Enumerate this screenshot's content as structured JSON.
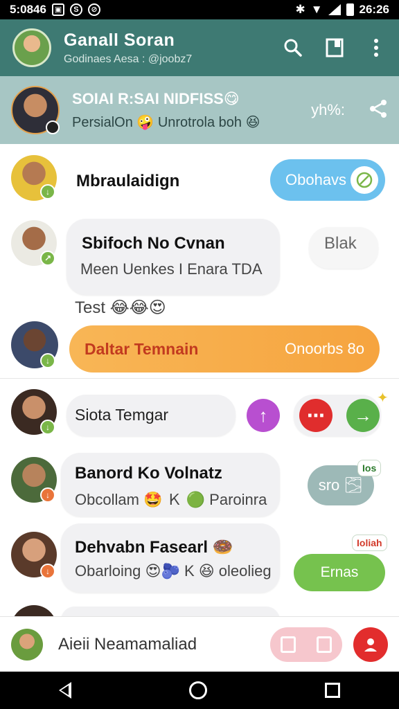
{
  "status_bar": {
    "time_left": "5:0846",
    "time_right": "26:26"
  },
  "app_bar": {
    "title": "Ganall Soran",
    "subtitle": "Godinaes Aesa : @joobz7"
  },
  "pinned": {
    "title": "SOIAI R:SAI NIDFISS😋",
    "subtitle": "PersialOn 🤪 Unrotrola boh 😆",
    "tag": "yh%:"
  },
  "chats": [
    {
      "name": "Mbraulaidign",
      "action_label": "Obohavs"
    },
    {
      "name": "Sbifoch No Cvnan",
      "preview": "Meen Uenkes I Enara TDA",
      "side_label": "Blak"
    },
    {
      "preview": "Test 😂😂😍",
      "banner_label": "Daltar Temnain",
      "banner_value": "Onoorbs 8o"
    },
    {
      "name": "Siota Temgar"
    },
    {
      "name": "Banord Ko Volnatz",
      "preview": "Obcollam 🤩 Ｋ 🟢 Paroinra",
      "side_label": "sro 🌫",
      "tag": "Ios"
    },
    {
      "name": "Dehvabn Fasearl 🍩",
      "preview": "Obarloing 😍🫐 K 😆 oleolieg",
      "action_label": "Ernas",
      "tag": "Ioliah"
    }
  ],
  "input_bar": {
    "placeholder": "Aieii Neamamaliad"
  },
  "colors": {
    "app_bar": "#3e7a73",
    "pinned": "#a7c6c4",
    "orange_banner": "#f6a84a",
    "send": "#e22d2d"
  }
}
